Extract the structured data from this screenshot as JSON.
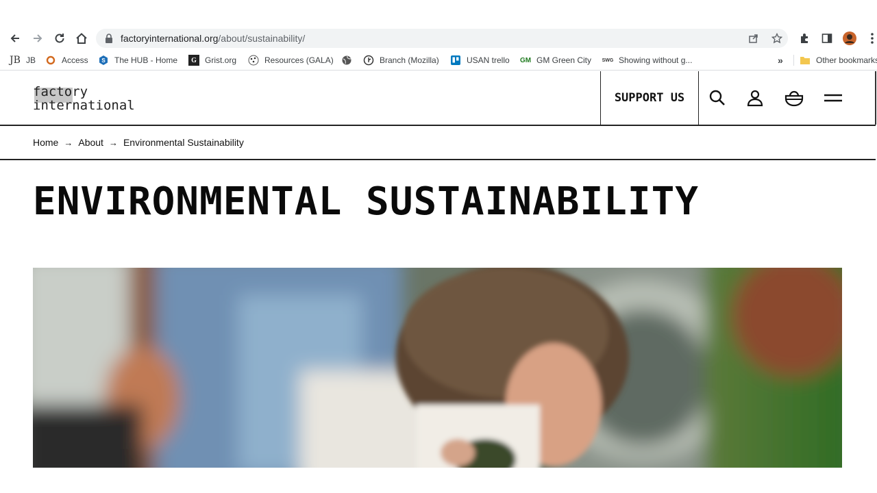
{
  "browser": {
    "url_domain": "factoryinternational.org",
    "url_path": "/about/sustainability/",
    "bookmarks": [
      {
        "label": "JB",
        "icon": "jb-icon"
      },
      {
        "label": "Access",
        "icon": "access-icon"
      },
      {
        "label": "The HUB - Home",
        "icon": "hub-icon"
      },
      {
        "label": "Grist.org",
        "icon": "grist-icon"
      },
      {
        "label": "Resources (GALA)",
        "icon": "gala-icon"
      },
      {
        "label": "",
        "icon": "globe-icon"
      },
      {
        "label": "Branch (Mozilla)",
        "icon": "branch-icon"
      },
      {
        "label": "USAN trello",
        "icon": "trello-icon"
      },
      {
        "label": "GM Green City",
        "icon": "gm-icon"
      },
      {
        "label": "Showing without g...",
        "icon": "swg-icon"
      }
    ],
    "other_bookmarks": "Other bookmarks",
    "overflow": "»"
  },
  "site": {
    "logo_line1": "factory",
    "logo_line2": "international",
    "support_label": "SUPPORT US",
    "breadcrumb": [
      "Home",
      "About",
      "Environmental Sustainability"
    ],
    "title": "ENVIRONMENTAL SUSTAINABILITY"
  },
  "colors": {
    "accent": "#111111",
    "logo_block": "#c7c7c7"
  }
}
